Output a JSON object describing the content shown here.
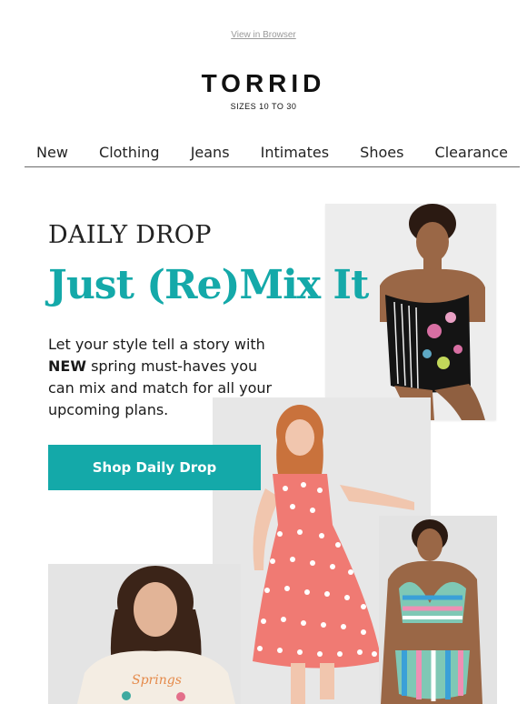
{
  "header": {
    "view_in_browser": "View in Browser",
    "logo": "TORRID",
    "tagline": "SIZES 10 TO 30"
  },
  "nav": {
    "items": [
      "New",
      "Clothing",
      "Jeans",
      "Intimates",
      "Shoes",
      "Clearance"
    ]
  },
  "hero": {
    "eyebrow": "DAILY DROP",
    "headline": "Just (Re)Mix It",
    "body_lead": "Let your style tell a story with",
    "body_bold": "NEW",
    "body_rest": "spring must-haves you can mix and match for all your upcoming plans.",
    "cta_label": "Shop Daily Drop"
  },
  "colors": {
    "accent": "#14a9a9",
    "text": "#1a1a1a"
  },
  "images": [
    {
      "name": "swimsuit-model-photo"
    },
    {
      "name": "polka-dot-dress-model-photo"
    },
    {
      "name": "striped-bikini-model-photo"
    },
    {
      "name": "graphic-tee-model-photo"
    }
  ]
}
